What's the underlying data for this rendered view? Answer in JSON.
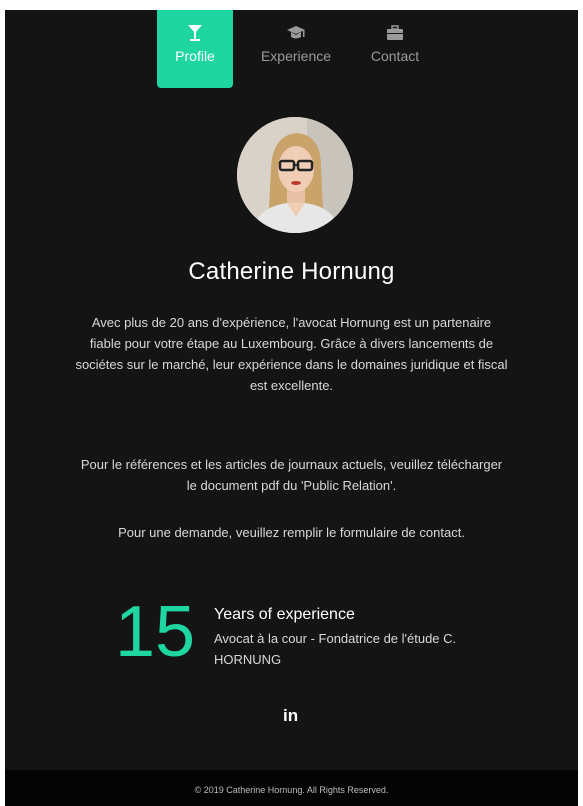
{
  "nav": {
    "tabs": [
      {
        "label": "Profile",
        "icon": "cocktail-icon",
        "active": true
      },
      {
        "label": "Experience",
        "icon": "graduation-cap-icon",
        "active": false
      },
      {
        "label": "Contact",
        "icon": "briefcase-icon",
        "active": false
      }
    ]
  },
  "profile": {
    "name": "Catherine Hornung",
    "bio": [
      "Avec plus de 20 ans d'expérience, l'avocat Hornung est un partenaire fiable pour votre étape au Luxembourg. Grâce à divers lancements de sociétes sur le marché, leur expérience dans le domaines juridique et fiscal est excellente.",
      "Pour le références et les articles de journaux actuels, veuillez télécharger le document pdf du 'Public Relation'.",
      "Pour une demande, veuillez remplir le formulaire de contact."
    ]
  },
  "stat": {
    "number": "15",
    "label": "Years of experience",
    "description": "Avocat à la cour - Fondatrice de l'étude C. HORNUNG"
  },
  "social": {
    "linkedin_label": "in"
  },
  "footer": {
    "text": "© 2019 Catherine Hornung. All Rights Reserved."
  },
  "colors": {
    "accent": "#1fd6a0",
    "background": "#141414"
  }
}
